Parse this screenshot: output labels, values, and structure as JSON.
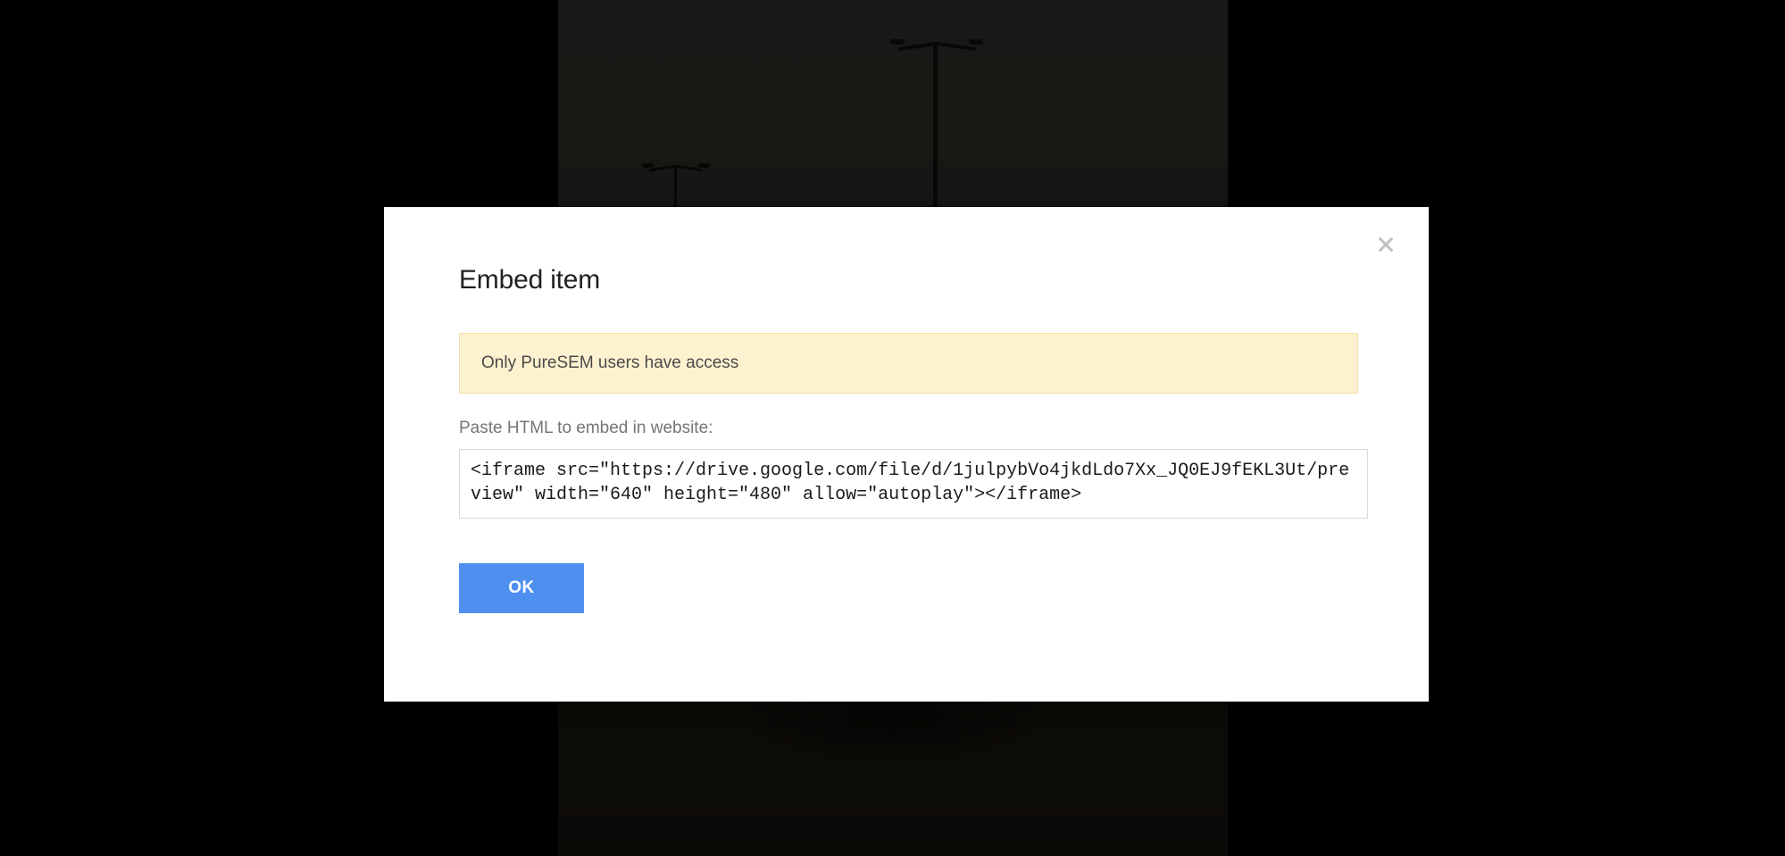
{
  "dialog": {
    "title": "Embed item",
    "info_message": "Only PureSEM users have access",
    "field_label": "Paste HTML to embed in website:",
    "embed_code": "<iframe src=\"https://drive.google.com/file/d/1julpybVo4jkdLdo7Xx_JQ0EJ9fEKL3Ut/preview\" width=\"640\" height=\"480\" allow=\"autoplay\"></iframe>",
    "ok_label": "OK"
  }
}
